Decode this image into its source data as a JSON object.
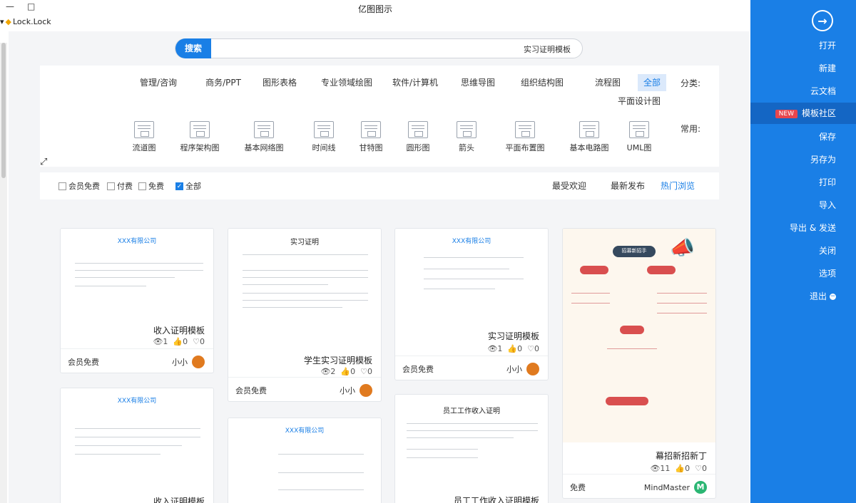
{
  "window": {
    "title": "亿图图示",
    "controls": [
      "—",
      "□"
    ],
    "user": "Lock.Lock"
  },
  "sidebar": {
    "back_icon": "→",
    "items": [
      {
        "label": "打开"
      },
      {
        "label": "新建"
      },
      {
        "label": "云文档"
      },
      {
        "label": "模板社区",
        "badge": "NEW",
        "active": true
      },
      {
        "label": "保存"
      },
      {
        "label": "另存为"
      },
      {
        "label": "打印"
      },
      {
        "label": "导入"
      },
      {
        "label": "导出 & 发送"
      },
      {
        "label": "关闭"
      },
      {
        "label": "选项"
      },
      {
        "label": "退出",
        "icon": "exit-icon"
      }
    ]
  },
  "search": {
    "button": "搜索",
    "value": "实习证明模板"
  },
  "categories": {
    "label": "分类:",
    "items": [
      "全部",
      "流程图",
      "组织结构图",
      "思维导图",
      "软件/计算机",
      "专业领域绘图",
      "图形表格",
      "商务/PPT",
      "管理/咨询",
      "平面设计图"
    ],
    "active": "全部"
  },
  "common": {
    "label": "常用:",
    "items": [
      "UML图",
      "基本电路图",
      "平面布置图",
      "箭头",
      "圆形图",
      "甘特图",
      "时间线",
      "基本网络图",
      "程序架构图",
      "流道图"
    ]
  },
  "sort": {
    "tabs": [
      "热门浏览",
      "最新发布",
      "最受欢迎"
    ],
    "active": "热门浏览",
    "filters": [
      {
        "label": "全部",
        "checked": true
      },
      {
        "label": "免费",
        "checked": false
      },
      {
        "label": "付费",
        "checked": false
      },
      {
        "label": "会员免费",
        "checked": false
      }
    ]
  },
  "cards": [
    {
      "title": "幕招新招新丁",
      "views": "11",
      "likes": "0",
      "comments": "0",
      "author": "MindMaster",
      "price": "免费",
      "doc_heading": "招募新招手"
    },
    {
      "title": "实习证明模板",
      "views": "1",
      "likes": "0",
      "comments": "0",
      "author": "小小",
      "price": "会员免费",
      "doc_heading": "XXX有限公司"
    },
    {
      "title": "学生实习证明模板",
      "views": "2",
      "likes": "0",
      "comments": "0",
      "author": "小小",
      "price": "会员免费",
      "doc_heading": "实习证明"
    },
    {
      "title": "收入证明模板",
      "views": "1",
      "likes": "0",
      "comments": "0",
      "author": "小小",
      "price": "会员免费",
      "doc_heading": "XXX有限公司"
    },
    {
      "title": "员工工作收入证明模板",
      "doc_heading": "员工工作收入证明"
    },
    {
      "title": "",
      "doc_heading": "XXX有限公司"
    },
    {
      "title": "收入证明模板",
      "doc_heading": "XXX有限公司"
    }
  ],
  "stat_icons": {
    "views": "👁",
    "likes": "👍",
    "comments": "♡"
  }
}
